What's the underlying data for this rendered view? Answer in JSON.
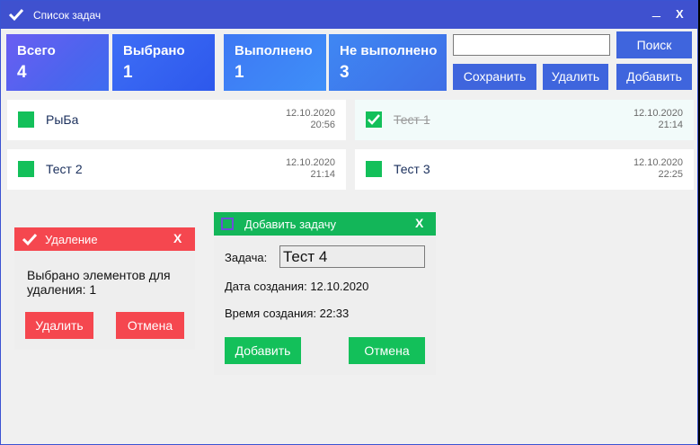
{
  "window": {
    "title": "Список задач",
    "minimize": "_",
    "close": "X"
  },
  "stats": {
    "total": {
      "label": "Всего",
      "value": "4"
    },
    "selected": {
      "label": "Выбрано",
      "value": "1"
    },
    "done": {
      "label": "Выполнено",
      "value": "1"
    },
    "not_done": {
      "label": "Не выполнено",
      "value": "3"
    }
  },
  "toolbar": {
    "search_value": "",
    "search_label": "Поиск",
    "save_label": "Сохранить",
    "delete_label": "Удалить",
    "add_label": "Добавить"
  },
  "tasks": [
    {
      "name": "РыБа",
      "date": "12.10.2020",
      "time": "20:56",
      "checked": false
    },
    {
      "name": "Тест 1",
      "date": "12.10.2020",
      "time": "21:14",
      "checked": true
    },
    {
      "name": "Тест 2",
      "date": "12.10.2020",
      "time": "21:14",
      "checked": false
    },
    {
      "name": "Тест 3",
      "date": "12.10.2020",
      "time": "22:25",
      "checked": false
    }
  ],
  "delete_dialog": {
    "title": "Удаление",
    "close": "X",
    "message": "Выбрано элементов для удаления: 1",
    "confirm_label": "Удалить",
    "cancel_label": "Отмена"
  },
  "add_dialog": {
    "title": "Добавить задачу",
    "close": "X",
    "task_label": "Задача:",
    "task_value": "Тест 4",
    "created_date": "Дата создания: 12.10.2020",
    "created_time": "Время создания: 22:33",
    "add_label": "Добавить",
    "cancel_label": "Отмена"
  },
  "colors": {
    "titlebar": "#3f51cf",
    "accent_blue": "#3f65dd",
    "task_box": "#13c05a",
    "delete_red": "#f5474f",
    "add_green": "#13b659"
  }
}
